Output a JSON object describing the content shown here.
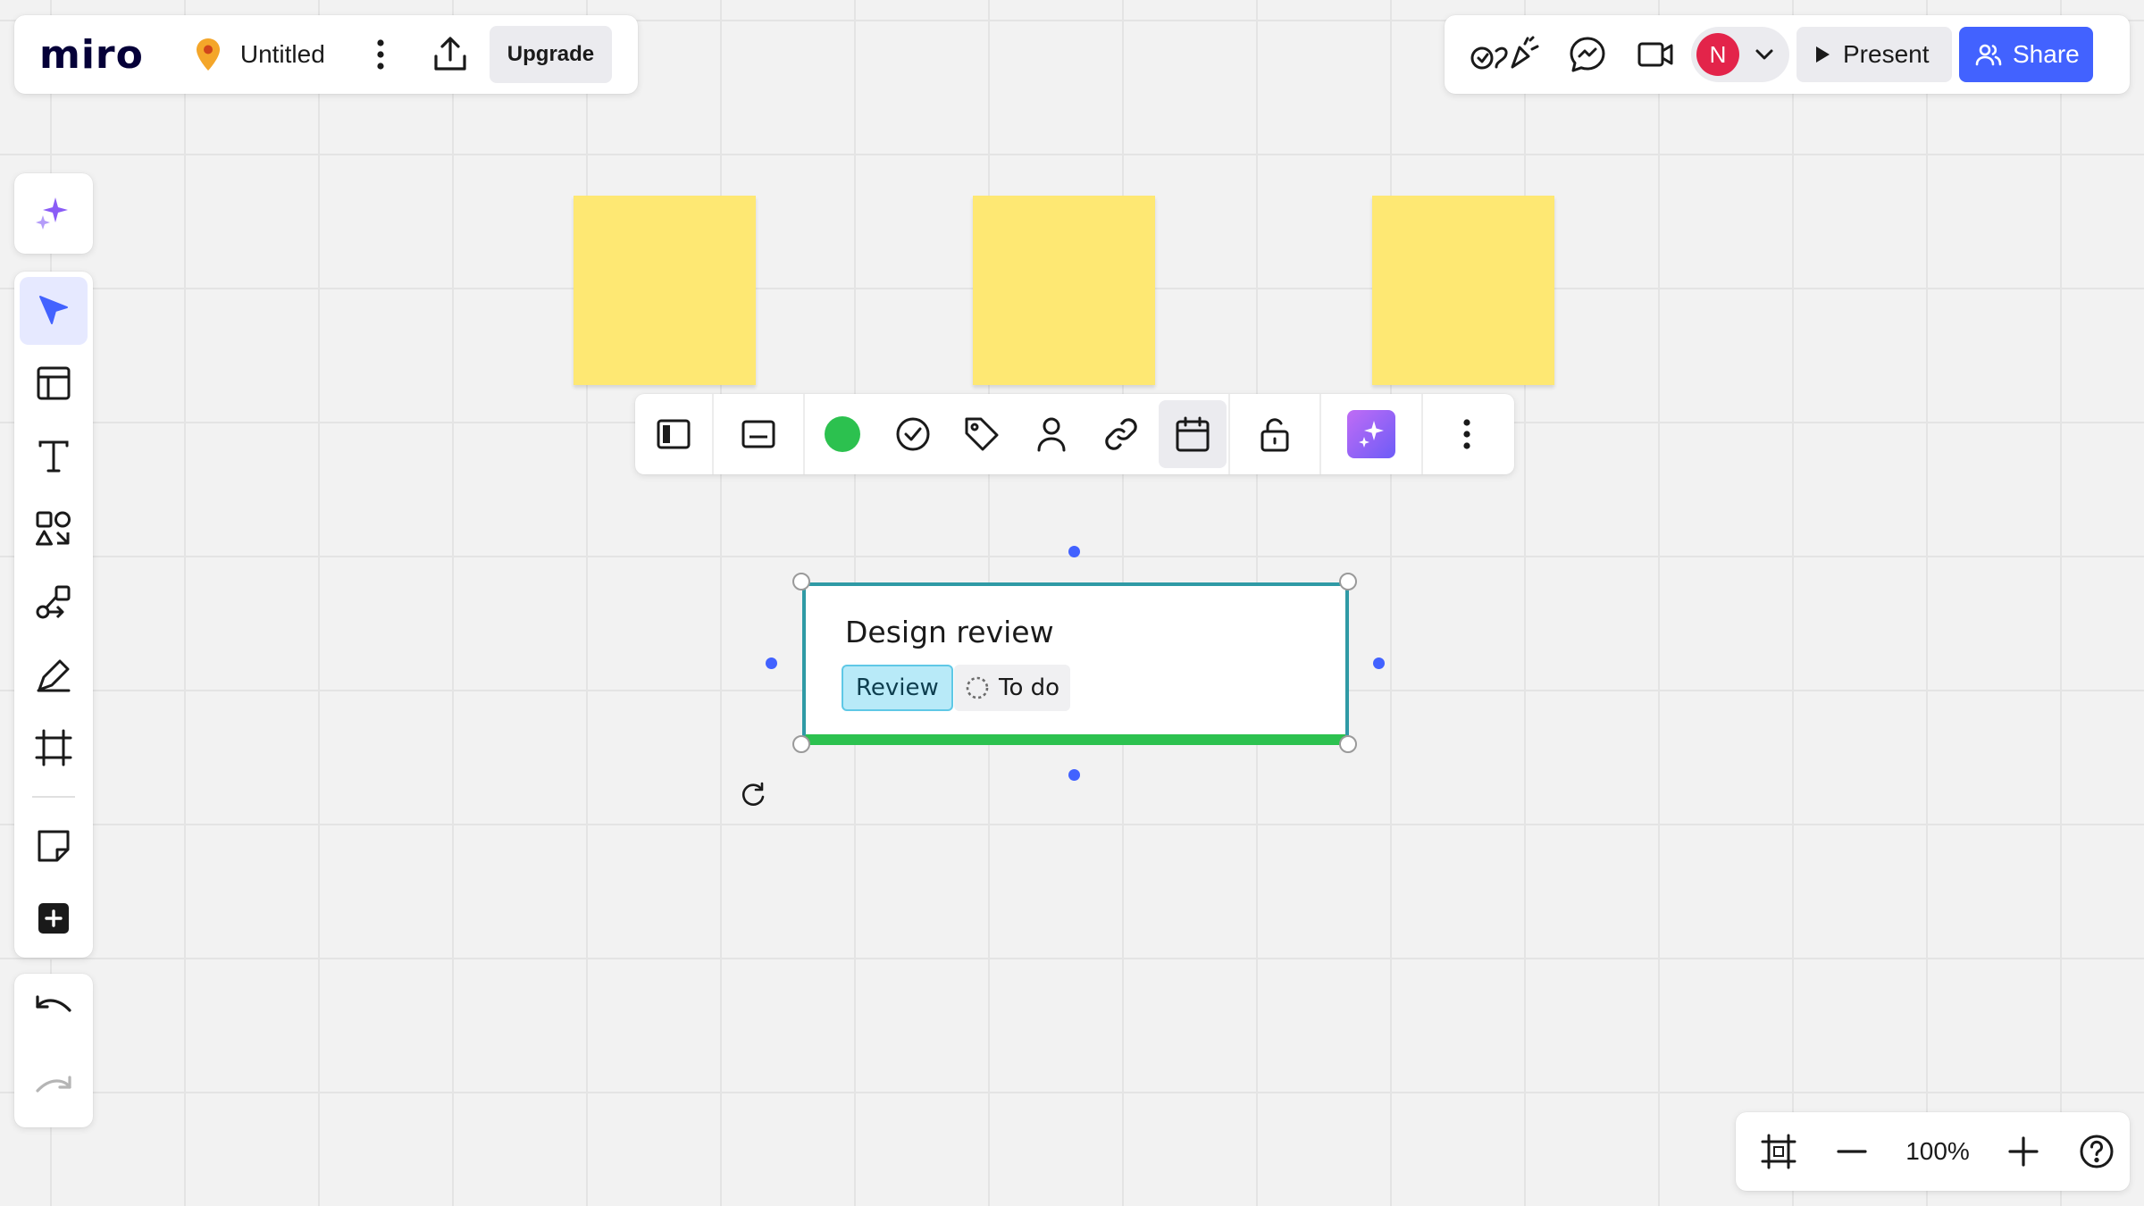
{
  "app": {
    "logo_text": "miro",
    "board_title": "Untitled",
    "upgrade_label": "Upgrade"
  },
  "header": {
    "user_initial": "N",
    "present_label": "Present",
    "share_label": "Share",
    "accent_color": "#4262ff",
    "avatar_color": "#e3244a"
  },
  "left_toolbar": {
    "tools": [
      {
        "id": "select",
        "icon": "cursor-icon",
        "active": true
      },
      {
        "id": "templates",
        "icon": "templates-icon"
      },
      {
        "id": "text",
        "icon": "text-icon"
      },
      {
        "id": "shapes",
        "icon": "shapes-icon"
      },
      {
        "id": "connectors",
        "icon": "connector-icon"
      },
      {
        "id": "pen",
        "icon": "pen-icon"
      },
      {
        "id": "frame",
        "icon": "frame-icon"
      },
      {
        "id": "sticky-note",
        "icon": "sticky-note-icon"
      },
      {
        "id": "more-tools",
        "icon": "plus-square-icon"
      }
    ]
  },
  "canvas": {
    "sticky_color": "#fee873",
    "sticky_count": 3
  },
  "context_toolbar": {
    "items": [
      "card-layout-icon",
      "card-fields-icon",
      "color-swatch",
      "check-circle-icon",
      "tag-icon",
      "assignee-icon",
      "link-icon",
      "calendar-icon",
      "unlock-icon",
      "ai-sparkle-icon",
      "more-vertical-icon"
    ],
    "selected_color": "#2cc14f",
    "selected_item": "calendar-icon"
  },
  "card": {
    "title": "Design review",
    "tag_label": "Review",
    "status_label": "To do",
    "border_color": "#2f9aa5",
    "bottom_color": "#2cc14f"
  },
  "zoom": {
    "level": "100%"
  }
}
